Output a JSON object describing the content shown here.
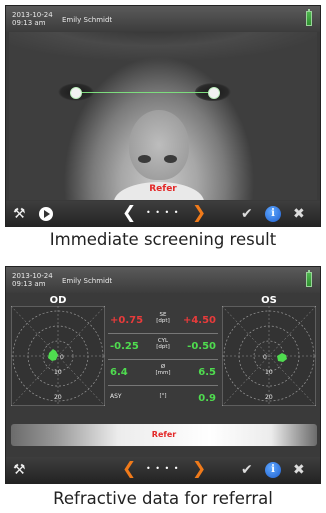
{
  "screen1": {
    "header": {
      "date": "2013-10-24",
      "time": "09:13 am",
      "patient_name": "Emily Schmidt",
      "battery_icon": "battery-icon"
    },
    "photo": {
      "result_label": "Refer"
    },
    "toolbar": {
      "tools_icon": "wrench-screwdriver-icon",
      "play_icon": "play-icon",
      "prev_icon": "chevron-left-icon",
      "dots": "• • • •",
      "next_icon": "chevron-right-icon",
      "accept_icon": "check-icon",
      "info_label": "i",
      "close_icon": "close-icon"
    },
    "caption": "Immediate screening result"
  },
  "screen2": {
    "header": {
      "date": "2013-10-24",
      "time": "09:13 am",
      "patient_name": "Emily Schmidt"
    },
    "od": {
      "label": "OD",
      "ring_labels": [
        "0",
        "10",
        "20"
      ]
    },
    "os": {
      "label": "OS",
      "ring_labels": [
        "0",
        "10",
        "20"
      ]
    },
    "measurements": [
      {
        "od_value": "+0.75",
        "unit": "SE",
        "unit2": "[dpt]",
        "os_value": "+4.50",
        "color": "#e83b3b"
      },
      {
        "od_value": "-0.25",
        "unit": "CYL",
        "unit2": "[dpt]",
        "os_value": "-0.50",
        "color": "#4fdc4f"
      },
      {
        "od_value": "6.4",
        "unit": "Ø",
        "unit2": "[mm]",
        "os_value": "6.5",
        "color": "#4fdc4f"
      },
      {
        "od_value": "ASY",
        "unit": "[°]",
        "unit2": "",
        "os_value": "0.9",
        "color": "#4fdc4f"
      }
    ],
    "result_label": "Refer",
    "toolbar": {
      "tools_icon": "wrench-screwdriver-icon",
      "dots": "• • • •",
      "info_label": "i"
    },
    "caption": "Refractive data for referral"
  },
  "colors": {
    "accent_orange": "#f07a1a",
    "refer_red": "#e32828",
    "ok_green": "#4fdc4f",
    "info_blue": "#1f5fcf"
  }
}
